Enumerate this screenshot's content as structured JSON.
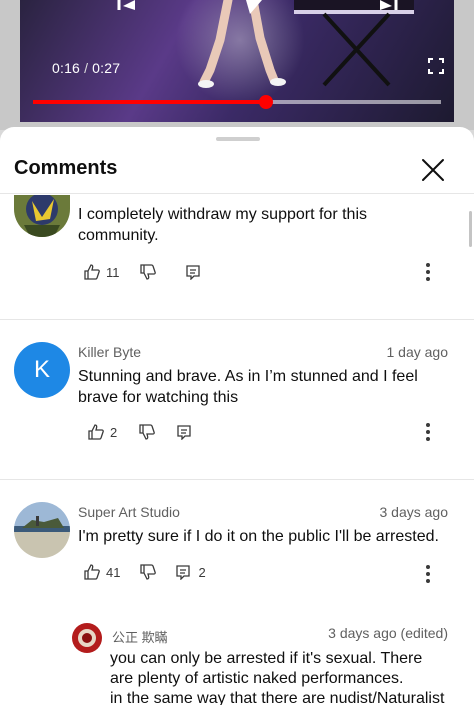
{
  "player": {
    "current_time": "0:16",
    "separator": "/",
    "duration": "0:27",
    "progress_fraction": 0.57,
    "accent_color": "#ff0000"
  },
  "sheet": {
    "title": "Comments",
    "close_icon": "close-icon"
  },
  "comments": [
    {
      "author": "",
      "time": "",
      "text_lines": [
        "I completely withdraw my support for this",
        "community."
      ],
      "likes": "11",
      "replies": ""
    },
    {
      "author": "Killer Byte",
      "time": "1 day ago",
      "avatar_letter": "K",
      "avatar_color": "#1e88e5",
      "text_lines": [
        "Stunning and brave. As in I’m stunned and I feel",
        "brave for watching this"
      ],
      "likes": "2",
      "replies": ""
    },
    {
      "author": "Super Art Studio",
      "time": "3 days ago",
      "text_lines": [
        "I'm pretty sure if I do it on the public I'll be arrested."
      ],
      "likes": "41",
      "replies": "2"
    }
  ],
  "reply": {
    "author": "公正 欺瞞",
    "time": "3 days ago (edited)",
    "text_lines": [
      "you can only be arrested if it's sexual.  There",
      "are plenty of artistic naked performances.",
      "in the same way that there are nudist/Naturalist"
    ]
  }
}
